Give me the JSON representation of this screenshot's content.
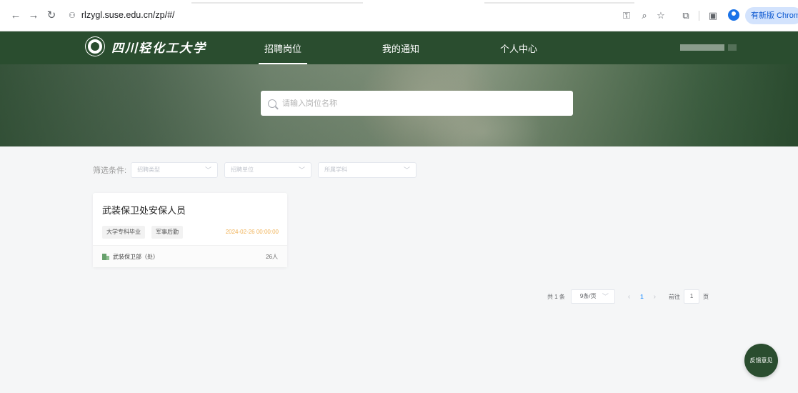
{
  "browser": {
    "url": "rlzygl.suse.edu.cn/zp/#/",
    "update_label": "有新版 Chrome"
  },
  "header": {
    "logo_text": "四川轻化工大学",
    "nav": [
      "招聘岗位",
      "我的通知",
      "个人中心"
    ],
    "active_nav": "招聘岗位",
    "brand_color": "#2a4d2f"
  },
  "search": {
    "placeholder": "请输入岗位名称"
  },
  "filters": {
    "label": "筛选条件:",
    "selects": [
      "招聘类型",
      "招聘单位",
      "所属学科"
    ]
  },
  "jobs": [
    {
      "title": "武装保卫处安保人员",
      "tags": [
        "大学专科毕业",
        "军事后勤"
      ],
      "date": "2024-02-26 00:00:00",
      "department": "武装保卫部（处）",
      "count": "26人"
    }
  ],
  "pagination": {
    "total": "共 1 条",
    "page_size": "9条/页",
    "current_page": "1",
    "goto_label": "前往",
    "goto_value": "1",
    "page_suffix": "页"
  },
  "feedback_label": "反馈意见"
}
